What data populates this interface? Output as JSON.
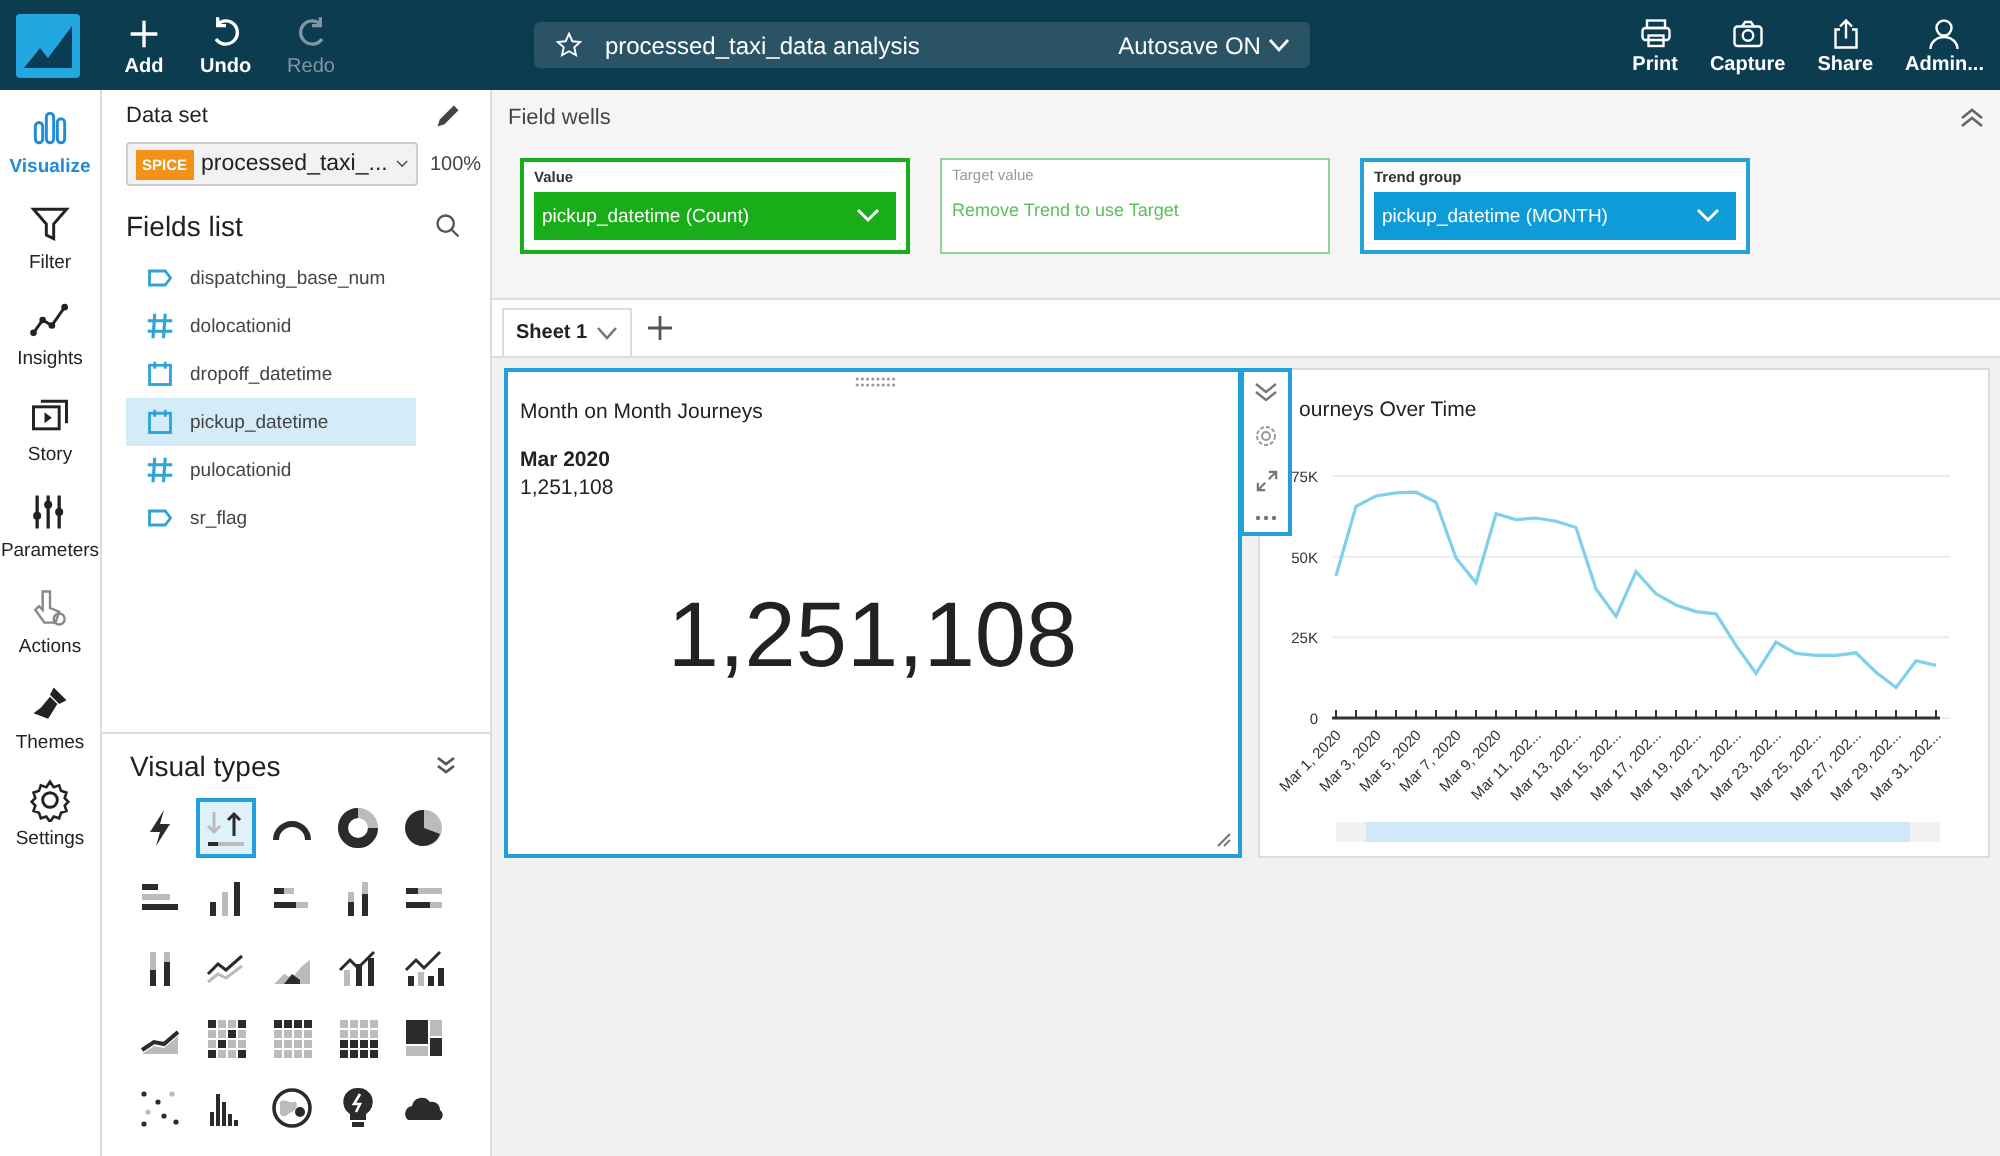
{
  "toolbar": {
    "actions": [
      {
        "label": "Add",
        "disabled": false
      },
      {
        "label": "Undo",
        "disabled": false
      },
      {
        "label": "Redo",
        "disabled": true
      }
    ],
    "analysis_title": "processed_taxi_data analysis",
    "autosave": "Autosave ON",
    "right_actions": [
      {
        "label": "Print"
      },
      {
        "label": "Capture"
      },
      {
        "label": "Share"
      },
      {
        "label": "Admin..."
      }
    ]
  },
  "nav": [
    {
      "label": "Visualize",
      "selected": true
    },
    {
      "label": "Filter",
      "selected": false
    },
    {
      "label": "Insights",
      "selected": false
    },
    {
      "label": "Story",
      "selected": false
    },
    {
      "label": "Parameters",
      "selected": false
    },
    {
      "label": "Actions",
      "selected": false
    },
    {
      "label": "Themes",
      "selected": false
    },
    {
      "label": "Settings",
      "selected": false
    }
  ],
  "data_set": {
    "title": "Data set",
    "badge": "SPICE",
    "name": "processed_taxi_...",
    "percent": "100%"
  },
  "fields_list": {
    "title": "Fields list",
    "fields": [
      {
        "name": "dispatching_base_num",
        "kind": "text",
        "selected": false
      },
      {
        "name": "dolocationid",
        "kind": "number",
        "selected": false
      },
      {
        "name": "dropoff_datetime",
        "kind": "date",
        "selected": false
      },
      {
        "name": "pickup_datetime",
        "kind": "date",
        "selected": true
      },
      {
        "name": "pulocationid",
        "kind": "number",
        "selected": false
      },
      {
        "name": "sr_flag",
        "kind": "text",
        "selected": false
      }
    ]
  },
  "visual_types": {
    "title": "Visual types",
    "items": [
      {
        "selected": false
      },
      {
        "selected": true
      },
      {
        "selected": false
      },
      {
        "selected": false
      },
      {
        "selected": false
      },
      {
        "selected": false
      },
      {
        "selected": false
      },
      {
        "selected": false
      },
      {
        "selected": false
      },
      {
        "selected": false
      },
      {
        "selected": false
      },
      {
        "selected": false
      },
      {
        "selected": false
      },
      {
        "selected": false
      },
      {
        "selected": false
      },
      {
        "selected": false
      },
      {
        "selected": false
      },
      {
        "selected": false
      },
      {
        "selected": false
      },
      {
        "selected": false
      },
      {
        "selected": false
      },
      {
        "selected": false
      },
      {
        "selected": false
      },
      {
        "selected": false
      },
      {
        "selected": false
      }
    ]
  },
  "field_wells": {
    "title": "Field wells",
    "wells": [
      {
        "label": "Value",
        "kind": "value",
        "value": "pickup_datetime (Count)",
        "disabled": false
      },
      {
        "label": "Target value",
        "kind": "target",
        "value": "Remove Trend to use Target",
        "disabled": true
      },
      {
        "label": "Trend group",
        "kind": "group",
        "value": "pickup_datetime (MONTH)",
        "disabled": false
      }
    ]
  },
  "sheets": [
    {
      "label": "Sheet 1",
      "selected": true
    }
  ],
  "kpi_visual": {
    "title": "Month on Month Journeys",
    "period": "Mar 2020",
    "small_value": "1,251,108",
    "value": "1,251,108",
    "selected": true
  },
  "line_visual": {
    "title": "ourneys Over Time",
    "chart_data": {
      "type": "line",
      "categories": [
        "Mar 1, 2020",
        null,
        "Mar 3, 2020",
        null,
        "Mar 5, 2020",
        null,
        "Mar 7, 2020",
        null,
        "Mar 9, 2020",
        null,
        "Mar 11, 202...",
        null,
        "Mar 13, 202...",
        null,
        "Mar 15, 202...",
        null,
        "Mar 17, 202...",
        null,
        "Mar 19, 202...",
        null,
        "Mar 21, 202...",
        null,
        "Mar 23, 202...",
        null,
        "Mar 25, 202...",
        null,
        "Mar 27, 202...",
        null,
        "Mar 29, 202...",
        null,
        "Mar 31, 202..."
      ],
      "ylim": [
        0,
        75000
      ],
      "grid": true,
      "yticks": [
        {
          "value": 0,
          "label": "0"
        },
        {
          "value": 25000,
          "label": "25K"
        },
        {
          "value": 50000,
          "label": "50K"
        },
        {
          "value": 75000,
          "label": "75K"
        }
      ],
      "series": [
        {
          "color": "#7fd0ea",
          "values": [
            44000,
            65600,
            68800,
            69800,
            70000,
            66900,
            49600,
            41900,
            63300,
            61500,
            62000,
            61000,
            59000,
            40000,
            31500,
            45400,
            38500,
            35000,
            33000,
            32300,
            22500,
            13800,
            23500,
            20000,
            19400,
            19400,
            20200,
            14200,
            9400,
            17700,
            16300
          ]
        }
      ]
    }
  }
}
